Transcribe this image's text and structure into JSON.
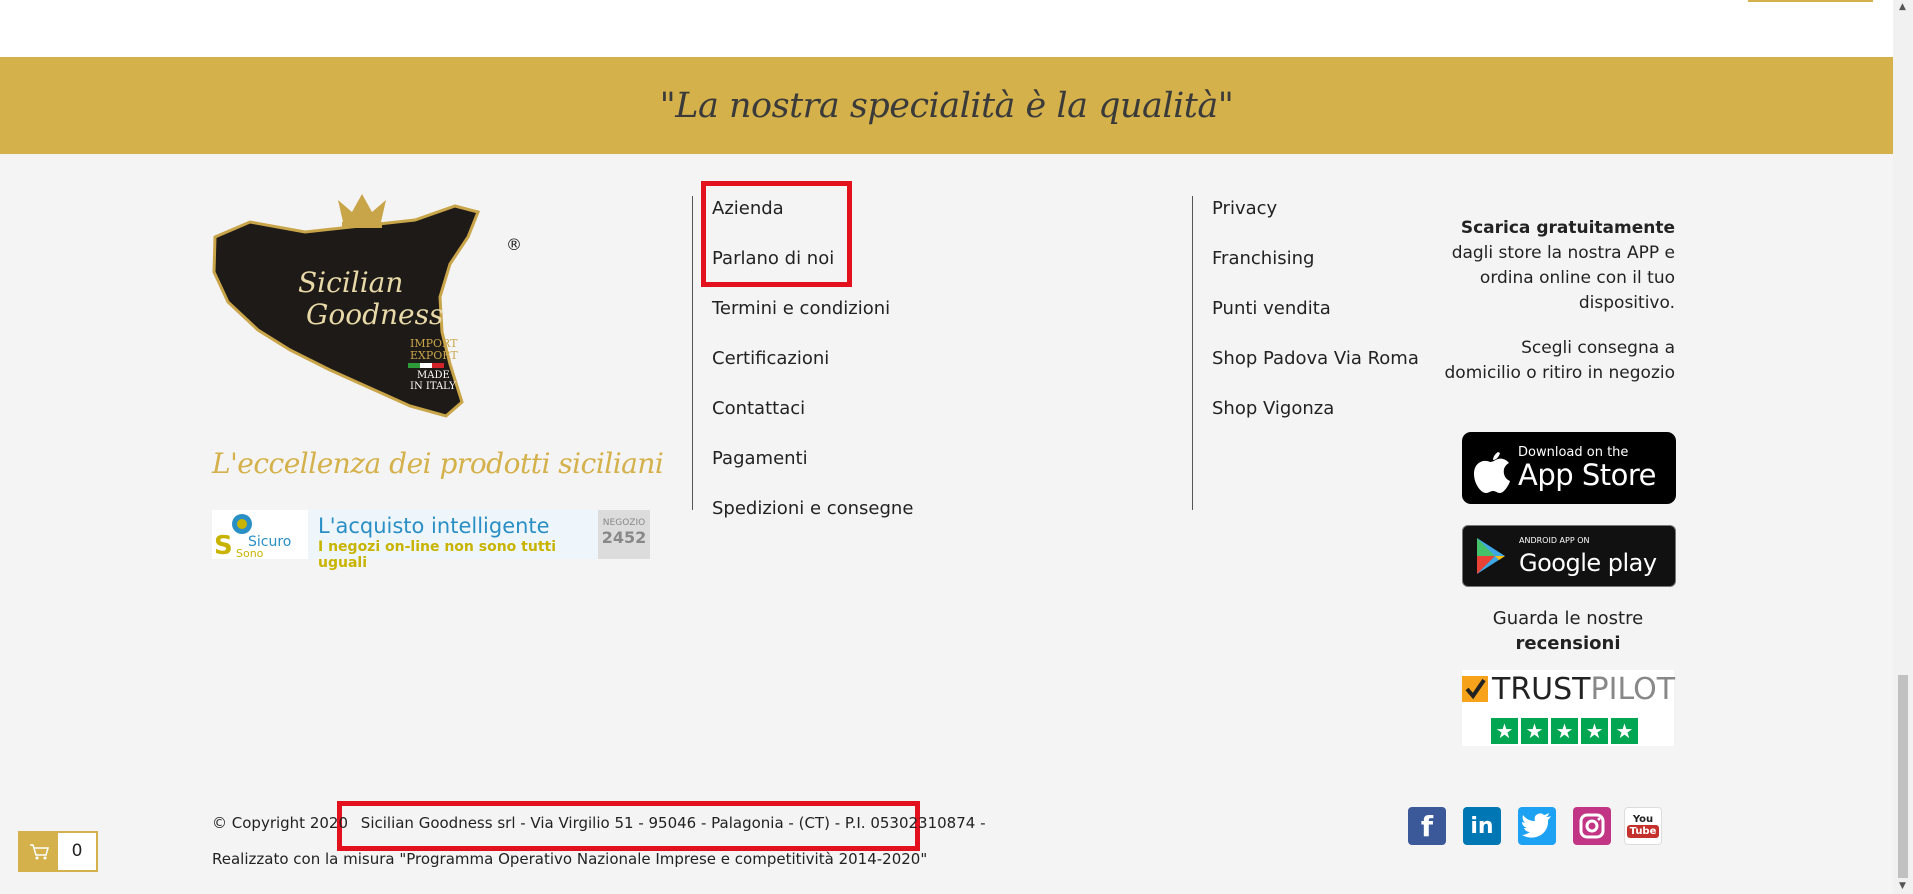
{
  "banner": {
    "text": "\"La nostra specialità è la qualità\""
  },
  "brand": {
    "logo_name_line1": "Sicilian",
    "logo_name_line2": "Goodness",
    "logo_badge_line1": "IMPORT",
    "logo_badge_line2": "EXPORT",
    "logo_badge_line3": "MADE",
    "logo_badge_line4": "IN ITALY",
    "registered": "®",
    "tagline": "L'eccellenza dei prodotti siciliani"
  },
  "sicuro_badge": {
    "logo_top": "Sicuro",
    "logo_bottom": "Sono",
    "title": "L'acquisto intelligente",
    "subtitle": "I negozi on-line non sono tutti uguali",
    "negozio_label": "NEGOZIO",
    "negozio_number": "2452"
  },
  "links_col1": [
    "Azienda",
    "Parlano di noi",
    "Termini e condizioni",
    "Certificazioni",
    "Contattaci",
    "Pagamenti",
    "Spedizioni e consegne"
  ],
  "links_col2": [
    "Privacy",
    "Franchising",
    "Punti vendita",
    "Shop Padova Via Roma",
    "Shop Vigonza"
  ],
  "app": {
    "headline": "Scarica gratuitamente",
    "text": "dagli store la nostra APP e ordina online con il tuo dispositivo.",
    "text2": "Scegli consegna a domicilio o ritiro in negozio",
    "appstore_small": "Download on the",
    "appstore_big": "App Store",
    "googleplay_small": "ANDROID APP ON",
    "googleplay_big": "Google play"
  },
  "reviews": {
    "line1": "Guarda le nostre",
    "line2": "recensioni",
    "trustpilot_a": "TRUST",
    "trustpilot_b": "PILOT"
  },
  "footer": {
    "copyright": "© Copyright 2020",
    "company": "Sicilian Goodness srl - Via Virgilio 51 - 95046 - Palagonia - (CT) - P.I. 05302310874 -",
    "realizzato": "Realizzato con la misura \"Programma Operativo Nazionale Imprese e competitività 2014-2020\""
  },
  "social_icons": [
    "facebook-icon",
    "linkedin-icon",
    "twitter-icon",
    "instagram-icon",
    "youtube-icon"
  ],
  "cart": {
    "count": "0"
  },
  "colors": {
    "gold": "#d4b14a",
    "highlight": "#e3111d",
    "background": "#f4f4f4"
  }
}
